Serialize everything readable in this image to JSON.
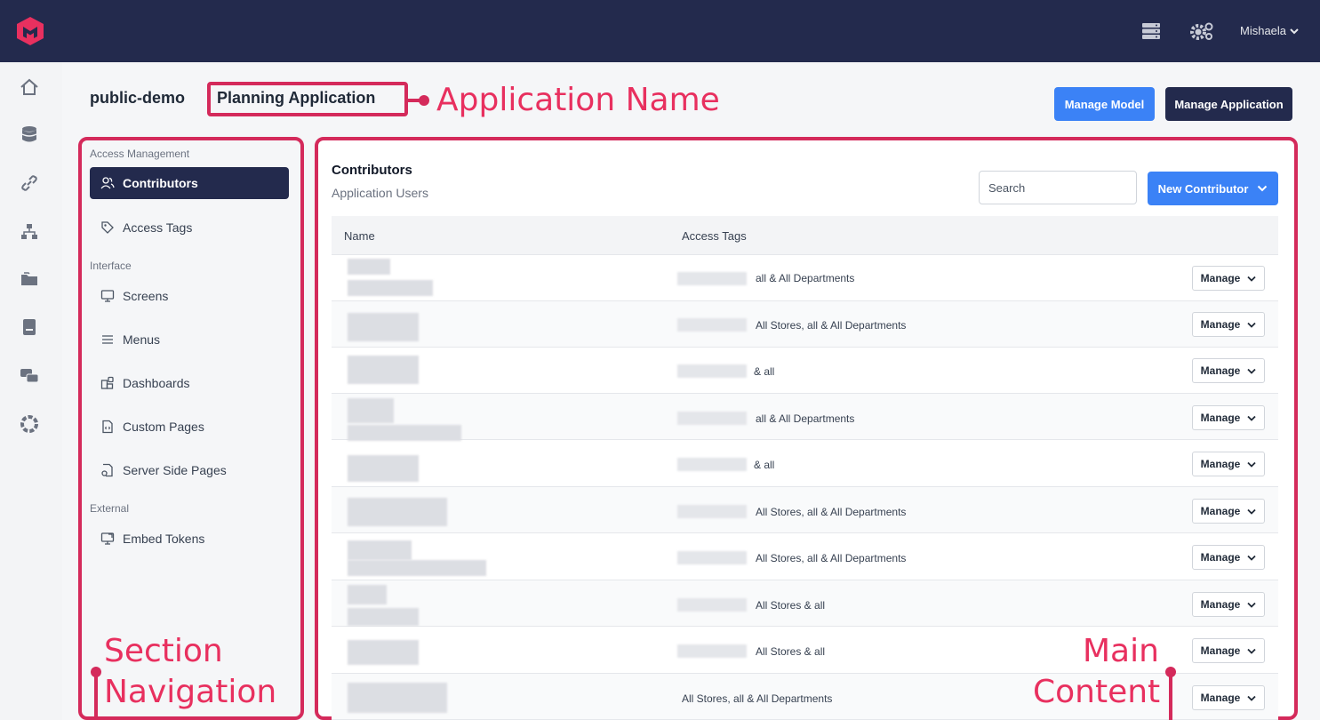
{
  "user": {
    "name": "Mishaela"
  },
  "breadcrumb": {
    "workspace": "public-demo",
    "application": "Planning Application"
  },
  "actions": {
    "manage_model": "Manage Model",
    "manage_application": "Manage Application"
  },
  "annotations": {
    "application_name": "Application Name",
    "section_navigation": [
      "Section",
      "Navigation"
    ],
    "main_content": [
      "Main",
      "Content"
    ]
  },
  "nav": {
    "groups": [
      {
        "label": "Access Management",
        "items": [
          {
            "label": "Contributors",
            "active": true,
            "icon": "users-icon"
          },
          {
            "label": "Access Tags",
            "icon": "tag-icon"
          }
        ]
      },
      {
        "label": "Interface",
        "items": [
          {
            "label": "Screens",
            "icon": "monitor-icon"
          },
          {
            "label": "Menus",
            "icon": "menu-icon"
          },
          {
            "label": "Dashboards",
            "icon": "dashboard-icon"
          },
          {
            "label": "Custom Pages",
            "icon": "custom-page-icon"
          },
          {
            "label": "Server Side Pages",
            "icon": "server-page-icon"
          }
        ]
      },
      {
        "label": "External",
        "items": [
          {
            "label": "Embed Tokens",
            "icon": "embed-icon"
          }
        ]
      }
    ]
  },
  "panel": {
    "title": "Contributors",
    "subtitle": "Application Users",
    "search_placeholder": "Search",
    "new_button": "New Contributor",
    "columns": [
      "Name",
      "Access Tags"
    ],
    "row_action": "Manage",
    "rows": [
      {
        "tags": "all & All Departments"
      },
      {
        "tags": "All Stores, all & All Departments"
      },
      {
        "tags": "& all"
      },
      {
        "tags": "all & All Departments"
      },
      {
        "tags": "& all"
      },
      {
        "tags": "All Stores, all & All Departments"
      },
      {
        "tags": "All Stores, all & All Departments"
      },
      {
        "tags": "All Stores & all"
      },
      {
        "tags": "All Stores & all"
      },
      {
        "tags": "All Stores, all & All Departments"
      }
    ]
  },
  "colors": {
    "navy": "#232a4d",
    "blue": "#3b82f6",
    "annotation": "#d42a5b"
  },
  "rail_icons": [
    "home-icon",
    "database-icon",
    "link-icon",
    "sitemap-icon",
    "folders-icon",
    "book-icon",
    "chat-icon",
    "support-icon"
  ]
}
